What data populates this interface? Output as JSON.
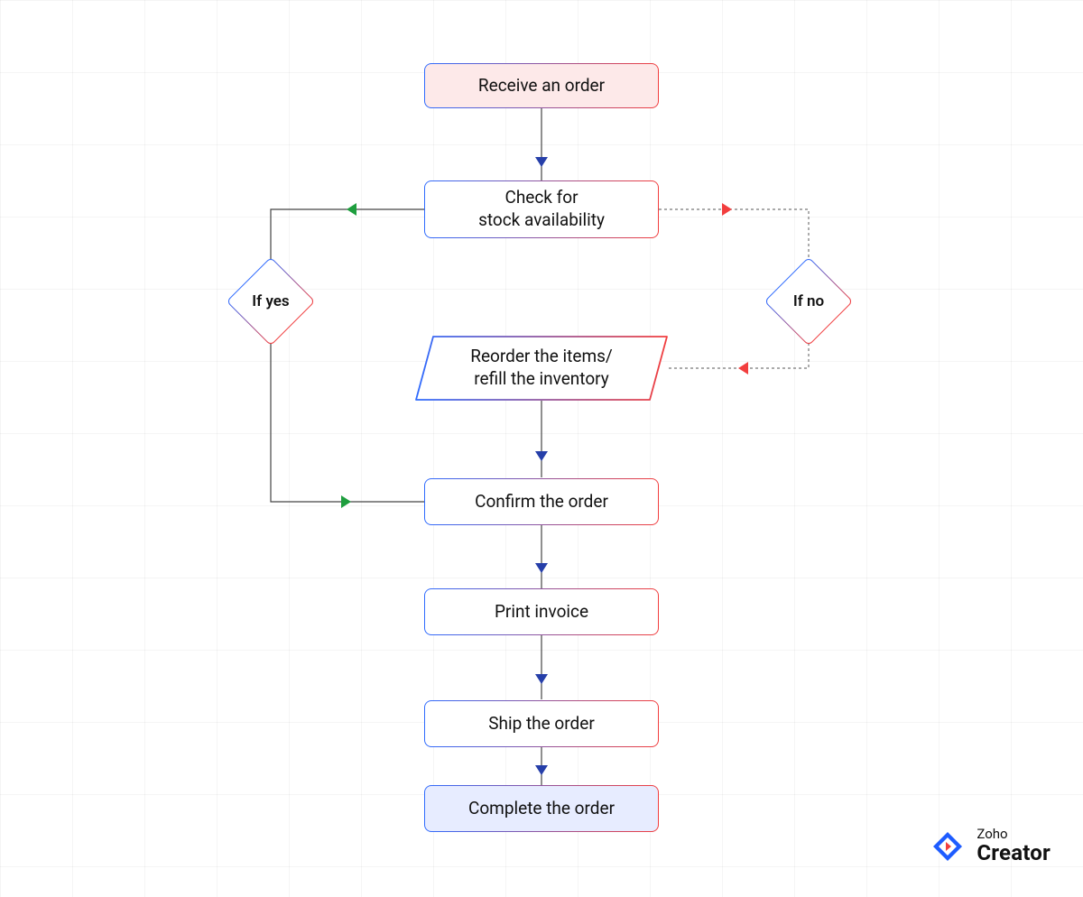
{
  "nodes": {
    "receive": {
      "label": "Receive an order"
    },
    "check": {
      "label": "Check for\nstock availability"
    },
    "reorder": {
      "label": "Reorder the items/\nrefill the inventory"
    },
    "confirm": {
      "label": "Confirm the order"
    },
    "print": {
      "label": "Print invoice"
    },
    "ship": {
      "label": "Ship the order"
    },
    "complete": {
      "label": "Complete the order"
    }
  },
  "decisions": {
    "yes": {
      "label": "If yes"
    },
    "no": {
      "label": "If no"
    }
  },
  "branding": {
    "top": "Zoho",
    "bottom": "Creator"
  },
  "colors": {
    "gradient_start": "#2E6BFF",
    "gradient_end": "#F23E3E",
    "arrow_blue": "#263FA9",
    "arrow_green": "#1E9E3E",
    "arrow_red": "#F23E3E",
    "start_fill": "#fde9e9",
    "end_fill": "#e7ecff"
  },
  "chart_data": {
    "type": "flowchart",
    "nodes": [
      {
        "id": "receive",
        "shape": "terminator",
        "label": "Receive an order",
        "role": "start"
      },
      {
        "id": "check",
        "shape": "process",
        "label": "Check for stock availability"
      },
      {
        "id": "dec_yes",
        "shape": "decision",
        "label": "If yes"
      },
      {
        "id": "dec_no",
        "shape": "decision",
        "label": "If no"
      },
      {
        "id": "reorder",
        "shape": "data",
        "label": "Reorder the items/ refill the inventory"
      },
      {
        "id": "confirm",
        "shape": "process",
        "label": "Confirm the order"
      },
      {
        "id": "print",
        "shape": "process",
        "label": "Print invoice"
      },
      {
        "id": "ship",
        "shape": "process",
        "label": "Ship the order"
      },
      {
        "id": "complete",
        "shape": "terminator",
        "label": "Complete the order",
        "role": "end"
      }
    ],
    "edges": [
      {
        "from": "receive",
        "to": "check",
        "style": "solid"
      },
      {
        "from": "check",
        "to": "dec_yes",
        "style": "solid",
        "color": "green",
        "label": "yes"
      },
      {
        "from": "check",
        "to": "dec_no",
        "style": "dashed",
        "color": "red",
        "label": "no"
      },
      {
        "from": "dec_no",
        "to": "reorder",
        "style": "dashed",
        "color": "red"
      },
      {
        "from": "reorder",
        "to": "confirm",
        "style": "solid"
      },
      {
        "from": "dec_yes",
        "to": "confirm",
        "style": "solid",
        "color": "green"
      },
      {
        "from": "confirm",
        "to": "print",
        "style": "solid"
      },
      {
        "from": "print",
        "to": "ship",
        "style": "solid"
      },
      {
        "from": "ship",
        "to": "complete",
        "style": "solid"
      }
    ]
  }
}
